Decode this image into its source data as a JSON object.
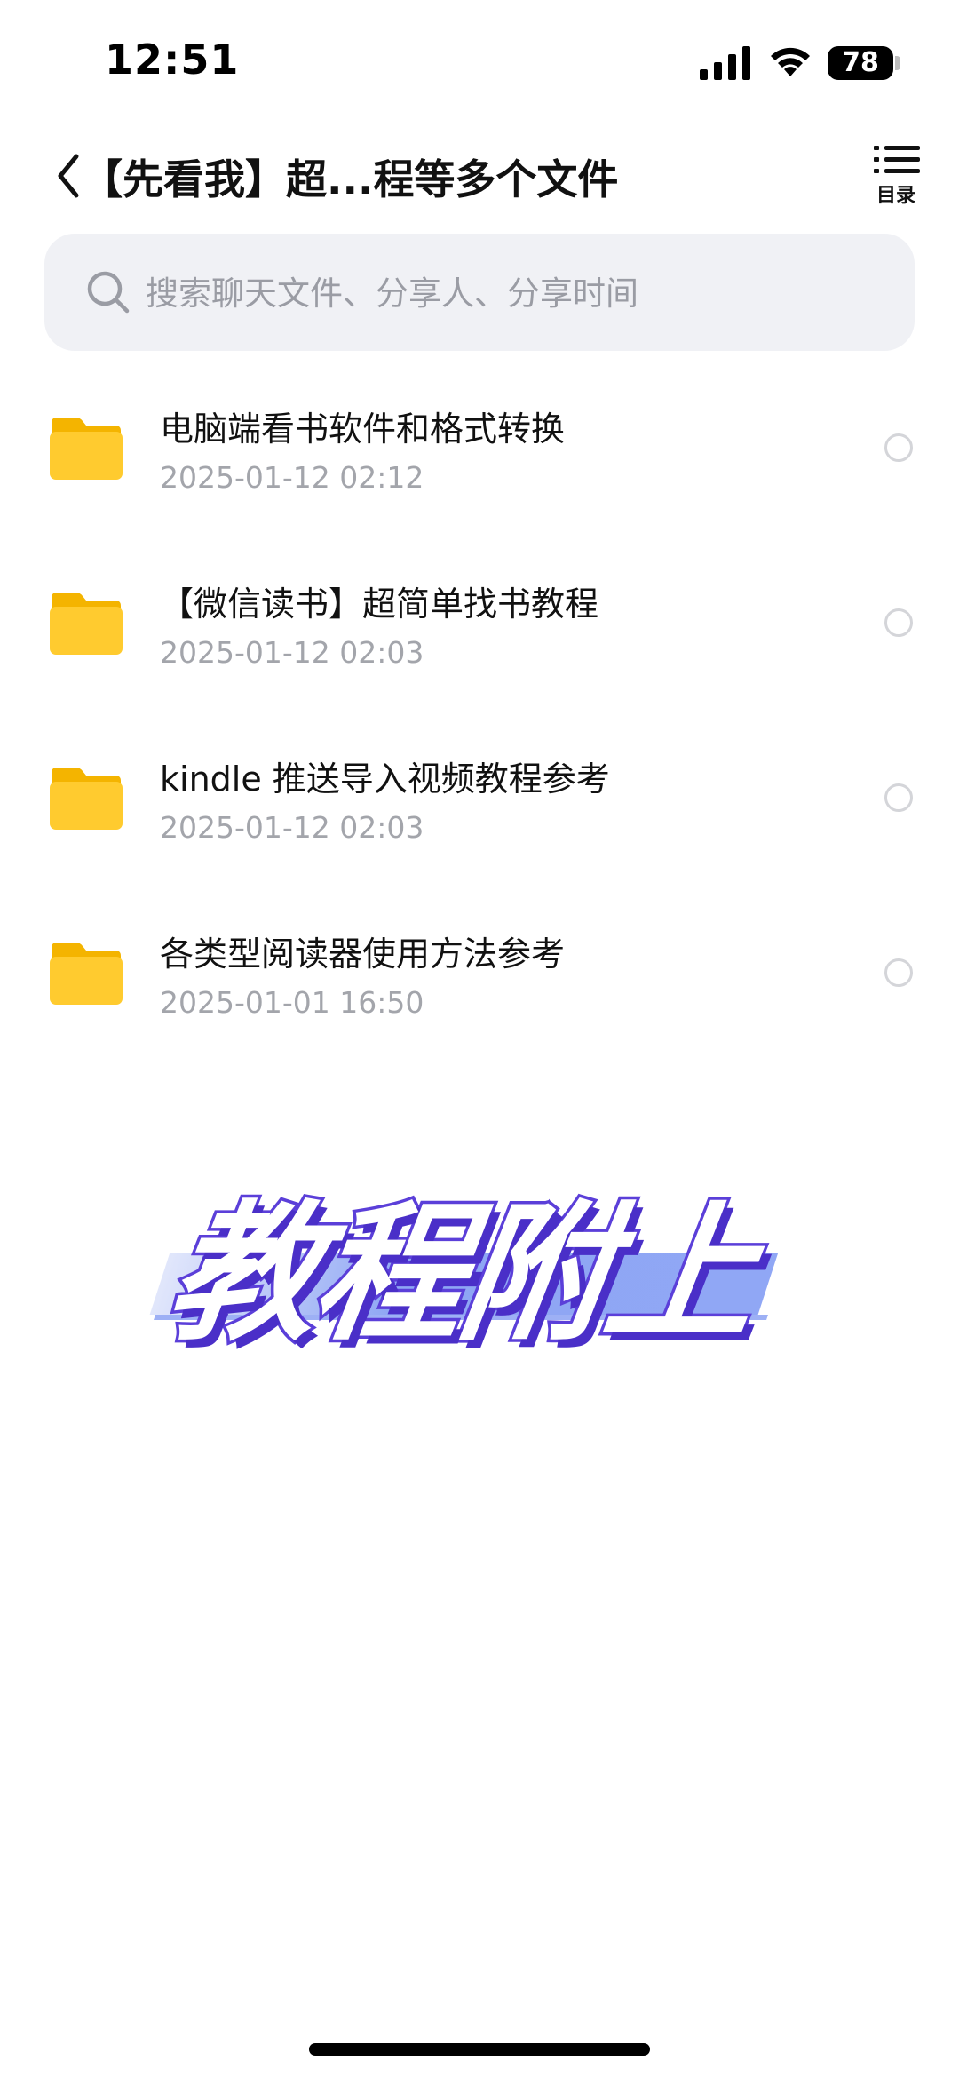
{
  "status_bar": {
    "time": "12:51",
    "battery": "78",
    "icons": [
      "signal-icon",
      "wifi-icon",
      "battery-icon"
    ]
  },
  "header": {
    "title": "【先看我】超...程等多个文件",
    "toc_label": "目录",
    "icons": [
      "back-icon",
      "list-icon"
    ]
  },
  "search": {
    "placeholder": "搜索聊天文件、分享人、分享时间",
    "value": ""
  },
  "files": [
    {
      "name": "电脑端看书软件和格式转换",
      "date": "2025-01-12 02:12",
      "icon": "folder-icon",
      "selected": false
    },
    {
      "name": "【微信读书】超简单找书教程",
      "date": "2025-01-12 02:03",
      "icon": "folder-icon",
      "selected": false
    },
    {
      "name": "kindle 推送导入视频教程参考",
      "date": "2025-01-12 02:03",
      "icon": "folder-icon",
      "selected": false
    },
    {
      "name": "各类型阅读器使用方法参考",
      "date": "2025-01-01 16:50",
      "icon": "folder-icon",
      "selected": false
    }
  ],
  "overlay": {
    "caption": "教程附上"
  },
  "colors": {
    "folder": "#FFCB2F",
    "caption_stroke": "#5B3FD9",
    "caption_highlight": "#8EA6F4",
    "search_bg": "#F0F1F5",
    "meta_text": "#A3A5AB"
  }
}
